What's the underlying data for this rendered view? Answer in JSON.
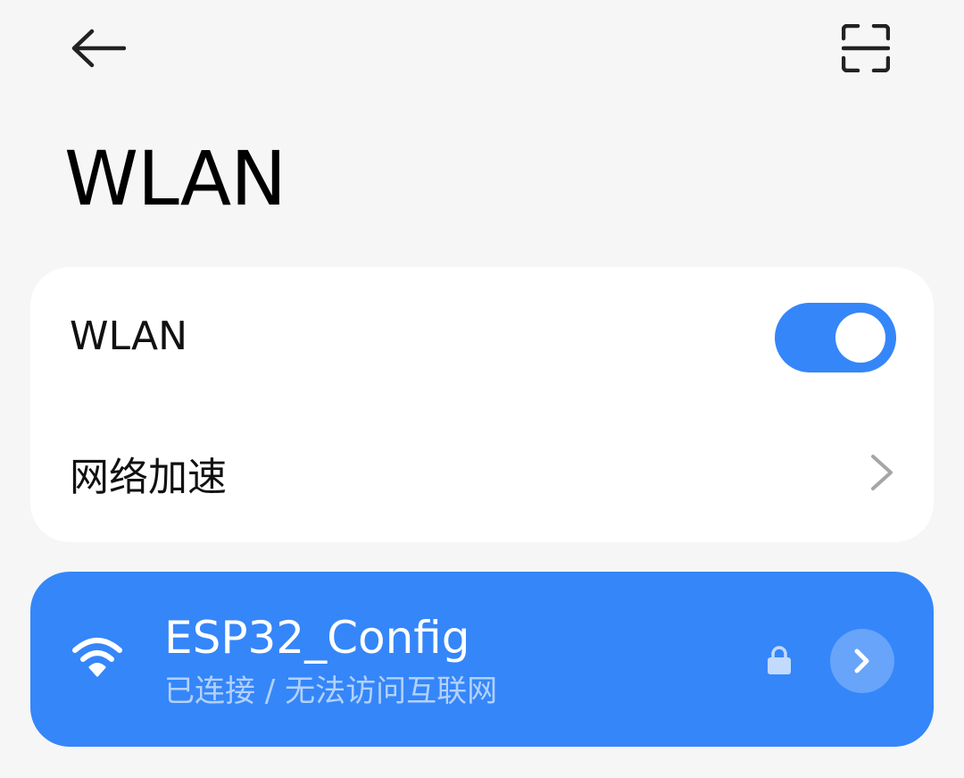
{
  "header": {
    "back_icon": "arrow-left-icon",
    "scan_icon": "scan-frame-icon",
    "title": "WLAN"
  },
  "settings_card": {
    "wlan_label": "WLAN",
    "wlan_enabled": true,
    "accel_label": "网络加速",
    "accel_icon": "chevron-right-icon"
  },
  "connected_network": {
    "name": "ESP32_Config",
    "status": "已连接 / 无法访问互联网",
    "signal_icon": "wifi-icon",
    "secured_icon": "lock-icon",
    "detail_icon": "chevron-right-icon"
  },
  "colors": {
    "accent": "#3586f9",
    "background": "#f6f6f6",
    "card": "#ffffff"
  }
}
